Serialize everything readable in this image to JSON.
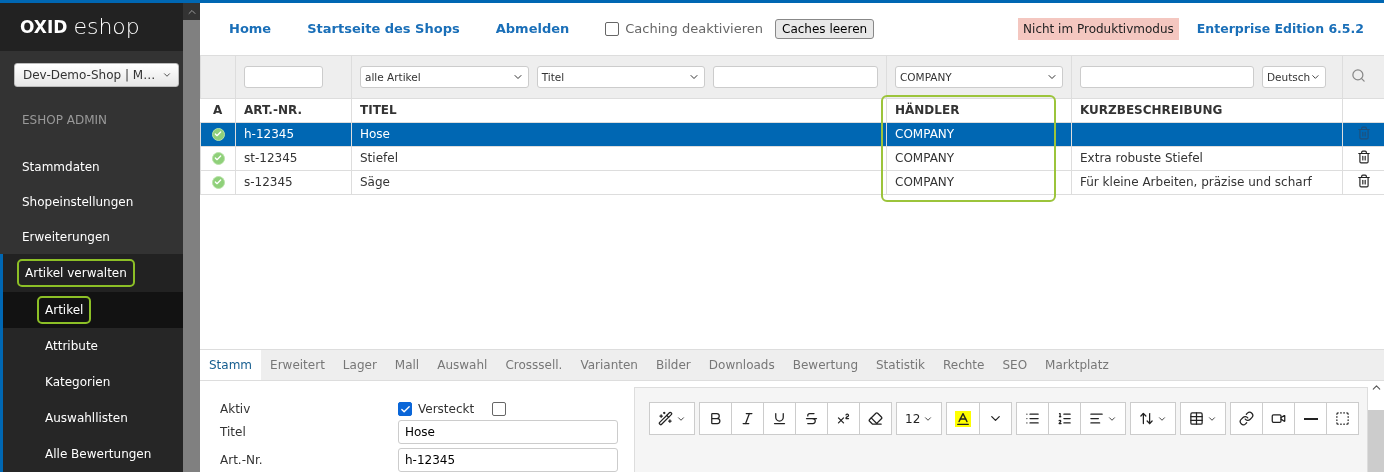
{
  "sidebar": {
    "logo": {
      "brand": "OXID",
      "product": "eshop"
    },
    "shop_select": "Dev-Demo-Shop | M…",
    "section": "ESHOP ADMIN",
    "items": [
      {
        "label": "Stammdaten"
      },
      {
        "label": "Shopeinstellungen"
      },
      {
        "label": "Erweiterungen"
      },
      {
        "label": "Artikel verwalten",
        "expanded": true,
        "highlighted": true,
        "children": [
          {
            "label": "Artikel",
            "selected": true,
            "highlighted": true
          },
          {
            "label": "Attribute",
            "selected": false
          },
          {
            "label": "Kategorien",
            "selected": false
          },
          {
            "label": "Auswahllisten",
            "selected": false
          },
          {
            "label": "Alle Bewertungen",
            "selected": false
          }
        ]
      }
    ]
  },
  "topbar": {
    "links": [
      "Home",
      "Startseite des Shops",
      "Abmelden"
    ],
    "caching": {
      "label": "Caching deaktivieren",
      "checked": false
    },
    "button": "Caches leeren",
    "badge": "Nicht im Produktivmodus",
    "edition": "Enterprise Edition 6.5.2"
  },
  "table": {
    "columns": [
      {
        "label": "A"
      },
      {
        "label": "ART.-NR.",
        "filters": [
          {
            "kind": "input"
          }
        ]
      },
      {
        "label": "TITEL",
        "filters": [
          {
            "kind": "select",
            "value": "alle Artikel"
          },
          {
            "kind": "select",
            "value": "Titel"
          },
          {
            "kind": "input"
          }
        ]
      },
      {
        "label": "HÄNDLER",
        "highlighted": true,
        "filters": [
          {
            "kind": "select",
            "value": "COMPANY"
          }
        ]
      },
      {
        "label": "KURZBESCHREIBUNG",
        "filters": [
          {
            "kind": "input"
          },
          {
            "kind": "select",
            "value": "Deutsch"
          }
        ]
      }
    ],
    "rows": [
      {
        "active": true,
        "selected": true,
        "cells": [
          "",
          "h-12345",
          "Hose",
          "COMPANY",
          null
        ]
      },
      {
        "active": true,
        "selected": false,
        "cells": [
          "",
          "st-12345",
          "Stiefel",
          "COMPANY",
          "Extra robuste Stiefel"
        ]
      },
      {
        "active": true,
        "selected": false,
        "cells": [
          "",
          "s-12345",
          "Säge",
          "COMPANY",
          "Für kleine Arbeiten, präzise und scharf"
        ]
      }
    ]
  },
  "tabs": [
    {
      "label": "Stamm",
      "selected": true
    },
    {
      "label": "Erweitert",
      "selected": false
    },
    {
      "label": "Lager",
      "selected": false
    },
    {
      "label": "Mall",
      "selected": false
    },
    {
      "label": "Auswahl",
      "selected": false
    },
    {
      "label": "Crosssell.",
      "selected": false
    },
    {
      "label": "Varianten",
      "selected": false
    },
    {
      "label": "Bilder",
      "selected": false
    },
    {
      "label": "Downloads",
      "selected": false
    },
    {
      "label": "Bewertung",
      "selected": false
    },
    {
      "label": "Statistik",
      "selected": false
    },
    {
      "label": "Rechte",
      "selected": false
    },
    {
      "label": "SEO",
      "selected": false
    },
    {
      "label": "Marktplatz",
      "selected": false
    }
  ],
  "form": {
    "active": {
      "label": "Aktiv",
      "checked": true
    },
    "hidden": {
      "label": "Versteckt",
      "checked": false
    },
    "fields": [
      {
        "label": "Titel",
        "value": "Hose"
      },
      {
        "label": "Art.-Nr.",
        "value": "h-12345"
      }
    ]
  },
  "editor": {
    "toolbar": [
      [
        {
          "kind": "wand",
          "dropdown": true
        }
      ],
      [
        {
          "kind": "bold"
        },
        {
          "kind": "italic"
        },
        {
          "kind": "underline"
        },
        {
          "kind": "strike"
        },
        {
          "kind": "superscript"
        },
        {
          "kind": "eraser"
        }
      ],
      [
        {
          "kind": "size",
          "label": "12",
          "dropdown": true
        }
      ],
      [
        {
          "kind": "highlight"
        },
        {
          "kind": "caret"
        }
      ],
      [
        {
          "kind": "bullets"
        },
        {
          "kind": "numbers"
        },
        {
          "kind": "align",
          "dropdown": true
        }
      ],
      [
        {
          "kind": "lineheight",
          "dropdown": true
        }
      ],
      [
        {
          "kind": "table",
          "dropdown": true
        }
      ],
      [
        {
          "kind": "link"
        },
        {
          "kind": "video"
        },
        {
          "kind": "rule"
        },
        {
          "kind": "more"
        }
      ]
    ]
  }
}
